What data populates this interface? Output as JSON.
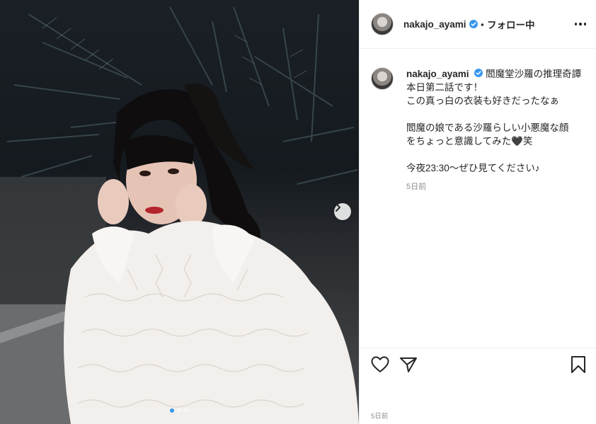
{
  "post": {
    "username": "nakajo_ayami",
    "follow_status": "・フォロー中",
    "caption": {
      "title": "閻魔堂沙羅の推理奇譚",
      "lines": [
        "本日第二話です！",
        "この真っ白の衣装も好きだったなぁ",
        "",
        "閻魔の娘である沙羅らしい小悪魔な顔",
        "をちょっと意識してみた🖤笑",
        "",
        "今夜23:30〜ぜひ見てください♪"
      ],
      "timestamp": "5日前"
    },
    "footer_timestamp": "5日前"
  },
  "carousel": {
    "total": 3,
    "current": 1
  },
  "colors": {
    "verified": "#3897f0",
    "border": "#efefef",
    "muted": "#8e8e8e"
  },
  "icons": [
    "verified-badge-icon",
    "more-options-icon",
    "heart-icon",
    "share-icon",
    "bookmark-icon",
    "chevron-right-icon"
  ]
}
